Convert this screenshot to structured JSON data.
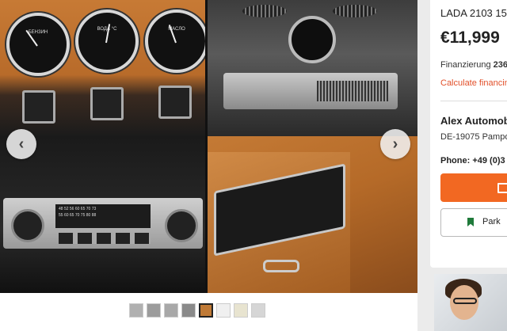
{
  "listing": {
    "title": "LADA 2103 150",
    "price": "€11,999",
    "financing_label": "Finanzierung",
    "financing_amount": "236",
    "calculate_link": "Calculate financin"
  },
  "dealer": {
    "name": "Alex Automob",
    "address": "DE-19075 Pampo",
    "phone_label": "Phone:",
    "phone_number": "+49 (0)3"
  },
  "actions": {
    "email_icon": "mail-icon",
    "park_label": "Park",
    "park_icon": "bookmark-icon"
  },
  "gallery": {
    "prev_glyph": "‹",
    "next_glyph": "›",
    "gauges": [
      {
        "label": "БЕНЗИН",
        "scale": "0 1/2 1/4"
      },
      {
        "label": "ВОДА °C",
        "scale": "50 90 130"
      },
      {
        "label": "МАСЛО",
        "scale": "0 4 8"
      }
    ],
    "radio_dial": [
      "48 52 56 60 65 70 73",
      "55 60 65 70 75 80 88"
    ]
  },
  "colors": {
    "accent_orange": "#f26822",
    "link_red": "#e2502a",
    "park_green": "#1f7a3a"
  }
}
